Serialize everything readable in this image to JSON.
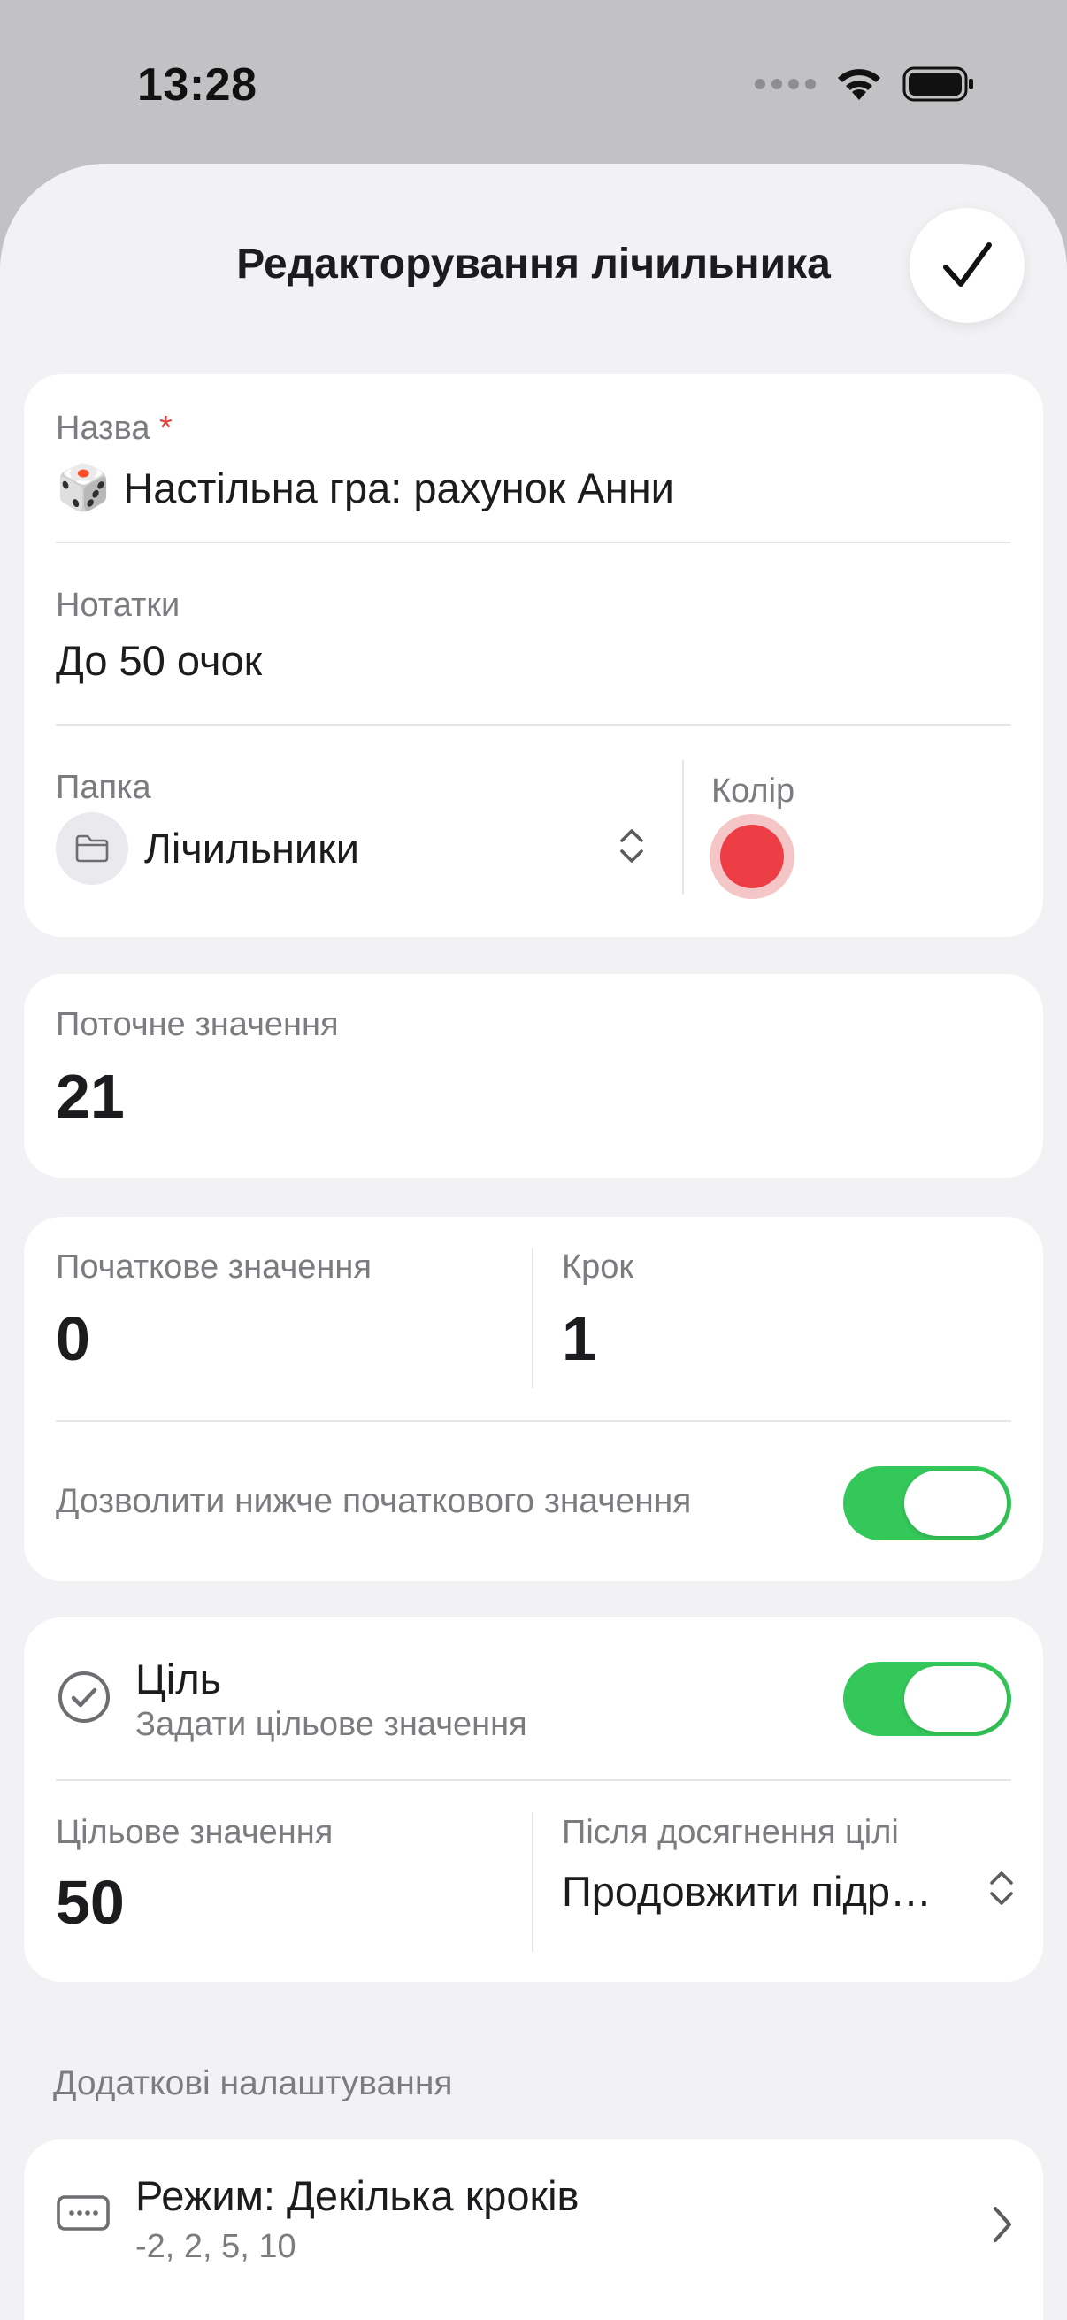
{
  "status_bar": {
    "time": "13:28"
  },
  "header": {
    "title": "Редакторування лічильника",
    "done_icon": "checkmark-icon"
  },
  "name_card": {
    "name_label": "Назва",
    "required_mark": "*",
    "name_emoji": "🎲",
    "name_value": "Настільна гра: рахунок Анни",
    "notes_label": "Нотатки",
    "notes_value": "До 50 очок",
    "folder_label": "Папка",
    "folder_value": "Лічильники",
    "color_label": "Колір",
    "color_value": "#ee3e45"
  },
  "current_card": {
    "label": "Поточне значення",
    "value": "21"
  },
  "range_card": {
    "initial_label": "Початкове значення",
    "initial_value": "0",
    "step_label": "Крок",
    "step_value": "1",
    "allow_below_label": "Дозволити нижче початкового значення",
    "allow_below_on": true
  },
  "goal_card": {
    "goal_title": "Ціль",
    "goal_subtitle": "Задати цільове значення",
    "goal_on": true,
    "target_label": "Цільове значення",
    "target_value": "50",
    "after_label": "Після досягнення цілі",
    "after_value": "Продовжити підр…"
  },
  "extra": {
    "section_label": "Додаткові налаштування",
    "mode_title": "Режим: Декілька кроків",
    "mode_steps": "-2, 2, 5, 10"
  },
  "colors": {
    "accent_green": "#34c759",
    "sheet_bg": "#f2f2f4",
    "card_bg": "#ffffff"
  }
}
